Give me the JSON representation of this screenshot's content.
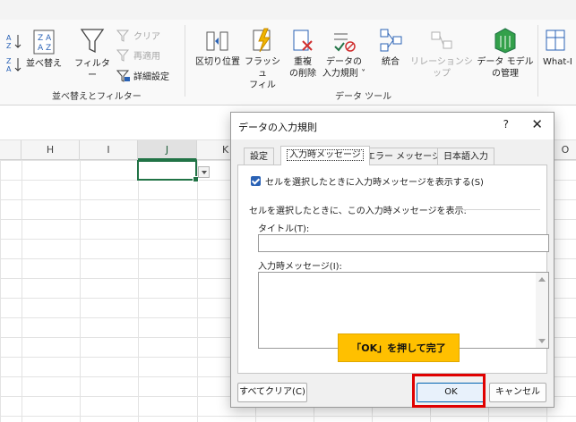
{
  "ribbon": {
    "sort_group": {
      "asc_icon": "sort-ascending-icon",
      "desc_icon": "sort-descending-icon",
      "sort_label": "並べ替え",
      "filter_label": "フィルター",
      "clear_label": "クリア",
      "reapply_label": "再適用",
      "advanced_label": "詳細設定",
      "group_label": "並べ替えとフィルター"
    },
    "data_tools": {
      "text_to_columns": "区切り位置",
      "flash_fill_line1": "フラッシュ",
      "flash_fill_line2": "フィル",
      "remove_dupes_line1": "重複",
      "remove_dupes_line2": "の削除",
      "validation_line1": "データの",
      "validation_line2": "入力規則 ˅",
      "consolidate": "統合",
      "relationships": "リレーションシップ",
      "data_model_line1": "データ モデル",
      "data_model_line2": "の管理",
      "group_label": "データ ツール"
    },
    "whatif_label": "What-I"
  },
  "grid": {
    "columns": [
      "H",
      "I",
      "J",
      "K",
      "O"
    ],
    "selected_column": "J"
  },
  "dialog": {
    "title": "データの入力規則",
    "help": "?",
    "close": "✕",
    "tabs": [
      "設定",
      "入力時メッセージ",
      "エラー メッセージ",
      "日本語入力"
    ],
    "active_tab": "入力時メッセージ",
    "show_message_checkbox": "セルを選択したときに入力時メッセージを表示する(S)",
    "show_message_checked": true,
    "section_label": "セルを選択したときに、この入力時メッセージを表示:",
    "title_label": "タイトル(T):",
    "title_value": "",
    "message_label": "入力時メッセージ(I):",
    "message_value": "",
    "clear_all": "すべてクリア(C)",
    "ok": "OK",
    "cancel": "キャンセル"
  },
  "annotation": {
    "callout": "「OK」を押して完了",
    "callout_color": "#ffc000",
    "highlight_color": "#e00000"
  },
  "colors": {
    "accent_green": "#217346",
    "checkbox_blue": "#2a62b5"
  }
}
